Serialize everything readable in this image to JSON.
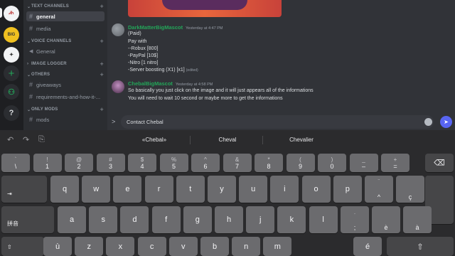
{
  "servers": [
    {
      "name": "server-1",
      "label": "ᏗᏂ"
    },
    {
      "name": "server-2",
      "label": "BIG"
    },
    {
      "name": "server-3",
      "label": "✦"
    }
  ],
  "rail_icons": {
    "add": "+",
    "explore": "⚇",
    "help": "?"
  },
  "categories": {
    "text": "TEXT CHANNELS",
    "voice": "VOICE CHANNELS",
    "image": "IMAGE LOGGER",
    "others": "OTHERS",
    "mods": "ONLY MODS"
  },
  "channels": {
    "general": "general",
    "media": "media",
    "voice_general": "General",
    "giveaways": "giveaways",
    "requirements": "requirements-and-how-it-...",
    "mods": "mods"
  },
  "messages": [
    {
      "author": "DarkMatterBigMascot",
      "timestamp": "Yesterday at 4:47 PM",
      "lines": [
        "(Paid)",
        "Pay with",
        "--Robux [800]",
        "-PayPal [10$]",
        "-Nitro [1 nitro]",
        "-Server boosting (X1) [x1]"
      ],
      "edited": "(edited)"
    },
    {
      "author": "ChebalBigMascot",
      "timestamp": "Yesterday at 4:58 PM",
      "lines": [
        "So basically you just click on the image and it will just appears all of the informations",
        "You will need to wait 10 second or maybe more to get the informations"
      ]
    }
  ],
  "input": {
    "value": "Contact Chebal",
    "prompt_glyph": ">",
    "send_glyph": "➤"
  },
  "keyboard": {
    "suggestions": [
      "«Chebal»",
      "Cheval",
      "Chevalier"
    ],
    "tools": {
      "undo": "↶",
      "redo": "↷",
      "paste": "⎘"
    },
    "row1": [
      {
        "top": "`",
        "bot": "\\"
      },
      {
        "top": "!",
        "bot": "1"
      },
      {
        "top": "@",
        "bot": "2"
      },
      {
        "top": "#",
        "bot": "3"
      },
      {
        "top": "$",
        "bot": "4"
      },
      {
        "top": "%",
        "bot": "5"
      },
      {
        "top": "^",
        "bot": "6"
      },
      {
        "top": "&",
        "bot": "7"
      },
      {
        "top": "*",
        "bot": "8"
      },
      {
        "top": "(",
        "bot": "9"
      },
      {
        "top": ")",
        "bot": "0"
      },
      {
        "top": "_",
        "bot": "–"
      },
      {
        "top": "+",
        "bot": "="
      }
    ],
    "delete": "⌫",
    "tab": "⇥",
    "row2": [
      "q",
      "w",
      "e",
      "r",
      "t",
      "y",
      "u",
      "i",
      "o",
      "p"
    ],
    "row2_extra": [
      {
        "top": "¨",
        "bot": "^"
      },
      {
        "top": "",
        "bot": "ç"
      }
    ],
    "ime": "拼音",
    "row3": [
      "a",
      "s",
      "d",
      "f",
      "g",
      "h",
      "j",
      "k",
      "l"
    ],
    "row3_extra": [
      {
        "top": ".",
        "bot": ";"
      },
      {
        "top": "",
        "bot": "è"
      },
      {
        "top": "",
        "bot": "à"
      }
    ],
    "shift": "⇧",
    "row4": [
      "ù",
      "z",
      "x",
      "c",
      "v",
      "b",
      "n",
      "m"
    ],
    "row4_extra": [
      {
        "top": "",
        "bot": "é"
      }
    ]
  }
}
